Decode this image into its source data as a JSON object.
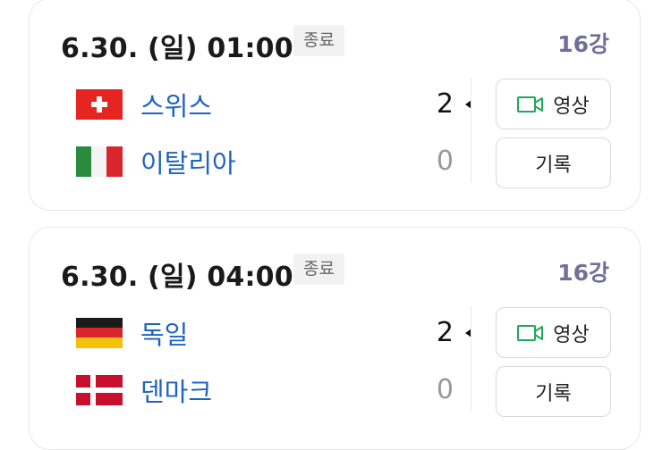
{
  "matches": [
    {
      "datetime": "6.30. (일) 01:00",
      "status": "종료",
      "round": "16강",
      "teams": [
        {
          "name": "스위스",
          "score": "2",
          "flag": "switzerland-flag-icon"
        },
        {
          "name": "이탈리아",
          "score": "0",
          "flag": "italy-flag-icon"
        }
      ],
      "video_label": "영상",
      "record_label": "기록"
    },
    {
      "datetime": "6.30. (일) 04:00",
      "status": "종료",
      "round": "16강",
      "teams": [
        {
          "name": "독일",
          "score": "2",
          "flag": "germany-flag-icon"
        },
        {
          "name": "덴마크",
          "score": "0",
          "flag": "denmark-flag-icon"
        }
      ],
      "video_label": "영상",
      "record_label": "기록"
    }
  ],
  "colors": {
    "team_link": "#1f63c2",
    "round": "#6f6f9a",
    "video_icon": "#1fa85a",
    "loser_score": "#999999"
  }
}
